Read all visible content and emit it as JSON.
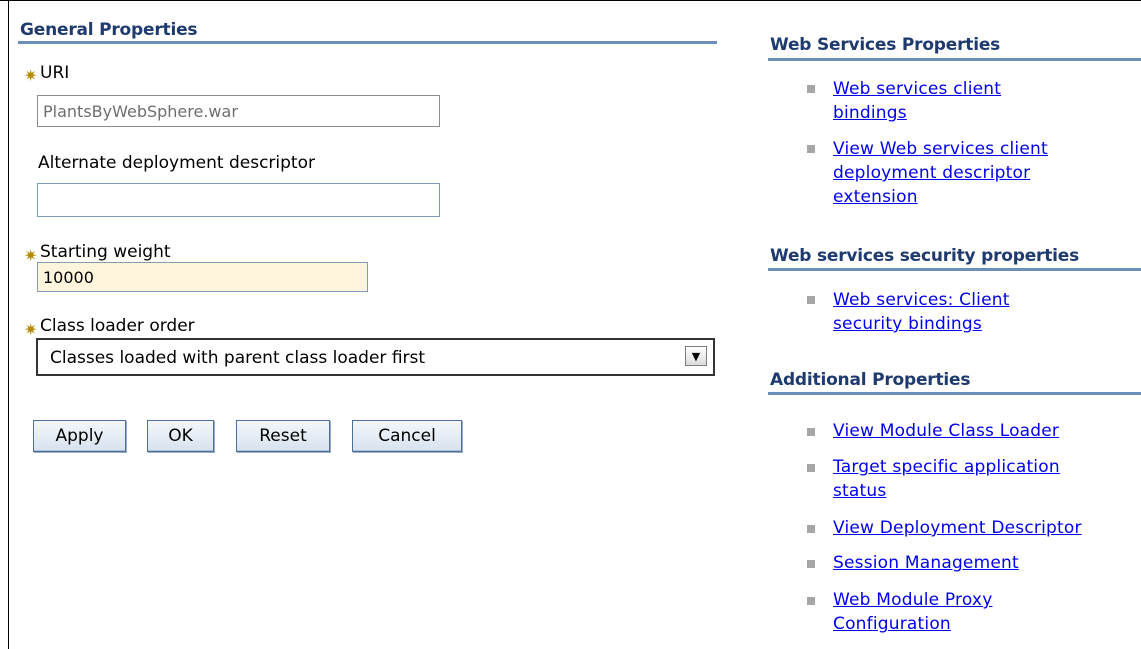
{
  "general": {
    "title": "General Properties",
    "uri_label": "URI",
    "uri_value": "PlantsByWebSphere.war",
    "alt_dd_label": "Alternate deployment descriptor",
    "alt_dd_value": "",
    "starting_weight_label": "Starting weight",
    "starting_weight_value": "10000",
    "class_loader_label": "Class loader order",
    "class_loader_value": "Classes loaded with parent class loader first",
    "required_marker": "✷"
  },
  "buttons": {
    "apply": "Apply",
    "ok": "OK",
    "reset": "Reset",
    "cancel": "Cancel"
  },
  "ws_properties": {
    "title": "Web Services Properties",
    "links": [
      {
        "line1": "Web services client",
        "line2": "bindings"
      },
      {
        "line1": "View Web services client",
        "line2": "deployment descriptor",
        "line3": "extension"
      }
    ]
  },
  "ws_security": {
    "title": "Web services security properties",
    "links": [
      {
        "line1": "Web services: Client",
        "line2": "security bindings"
      }
    ]
  },
  "additional": {
    "title": "Additional Properties",
    "links": [
      {
        "line1": "View Module Class Loader"
      },
      {
        "line1": "Target specific application",
        "line2": "status"
      },
      {
        "line1": "View Deployment Descriptor"
      },
      {
        "line1": "Session Management"
      },
      {
        "line1": "Web Module Proxy",
        "line2": "Configuration"
      }
    ]
  },
  "colors": {
    "section_title": "#1e3a6e",
    "section_rule": "#6b8fb8",
    "link": "#0000ee",
    "required_marker": "#b58a00",
    "required_field_bg": "#fff5dc"
  }
}
